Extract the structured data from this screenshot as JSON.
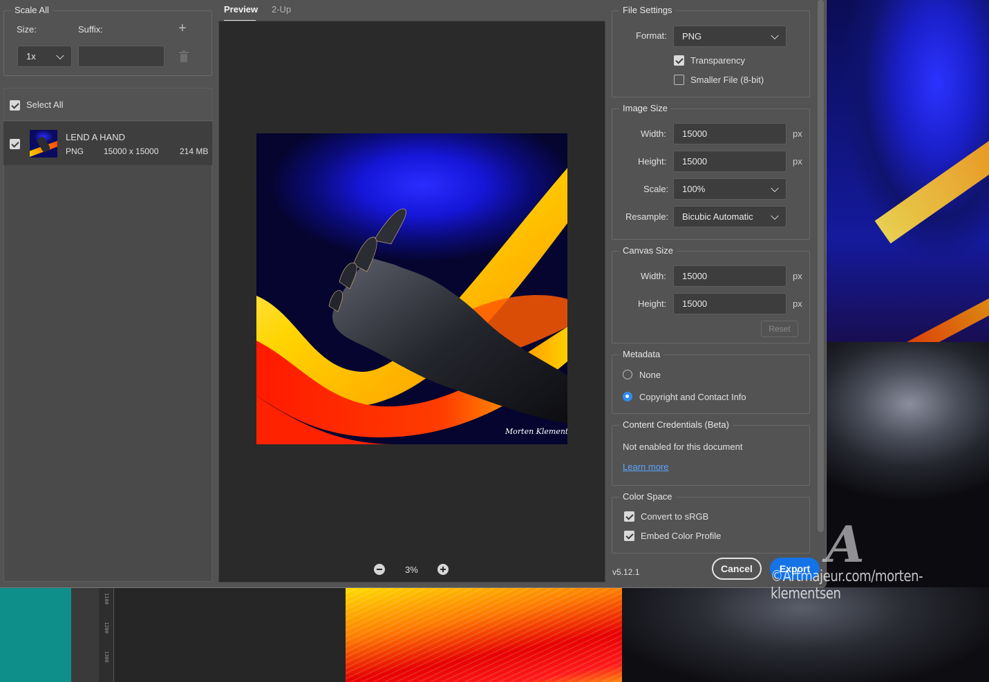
{
  "left_panel": {
    "scale_all": {
      "title": "Scale All",
      "size_label": "Size:",
      "suffix_label": "Suffix:",
      "size_value": "1x",
      "suffix_value": ""
    },
    "assets": {
      "select_all_label": "Select All",
      "items": [
        {
          "name": "LEND A HAND",
          "format": "PNG",
          "dimensions": "15000 x 15000",
          "size": "214 MB",
          "checked": true
        }
      ]
    }
  },
  "preview": {
    "tabs": [
      {
        "label": "Preview",
        "active": true
      },
      {
        "label": "2-Up",
        "active": false
      }
    ],
    "zoom": "3%"
  },
  "file_settings": {
    "title": "File Settings",
    "format_label": "Format:",
    "format_value": "PNG",
    "transparency_label": "Transparency",
    "transparency_checked": true,
    "smaller_file_label": "Smaller File (8-bit)",
    "smaller_file_checked": false
  },
  "image_size": {
    "title": "Image Size",
    "width_label": "Width:",
    "width_value": "15000",
    "height_label": "Height:",
    "height_value": "15000",
    "scale_label": "Scale:",
    "scale_value": "100%",
    "resample_label": "Resample:",
    "resample_value": "Bicubic Automatic",
    "unit": "px"
  },
  "canvas_size": {
    "title": "Canvas Size",
    "width_label": "Width:",
    "width_value": "15000",
    "height_label": "Height:",
    "height_value": "15000",
    "unit": "px",
    "reset_label": "Reset"
  },
  "metadata": {
    "title": "Metadata",
    "options": [
      {
        "label": "None",
        "selected": false
      },
      {
        "label": "Copyright and Contact Info",
        "selected": true
      }
    ]
  },
  "content_credentials": {
    "title": "Content Credentials (Beta)",
    "status": "Not enabled for this document",
    "link": "Learn more"
  },
  "color_space": {
    "title": "Color Space",
    "convert_label": "Convert to sRGB",
    "convert_checked": true,
    "embed_label": "Embed Color Profile",
    "embed_checked": true
  },
  "footer": {
    "version": "v5.12.1",
    "cancel_label": "Cancel",
    "export_label": "Export"
  },
  "watermark": {
    "text": "©Artmajeur.com/morten-klementsen"
  },
  "signature": "Morten Klementsen",
  "ruler_labels": [
    "1100",
    "1200",
    "1300"
  ],
  "colors": {
    "dialog_bg": "#535353",
    "accent": "#1473e6",
    "radio_selected": "#2f8cf0",
    "link": "#5aa6ff"
  }
}
